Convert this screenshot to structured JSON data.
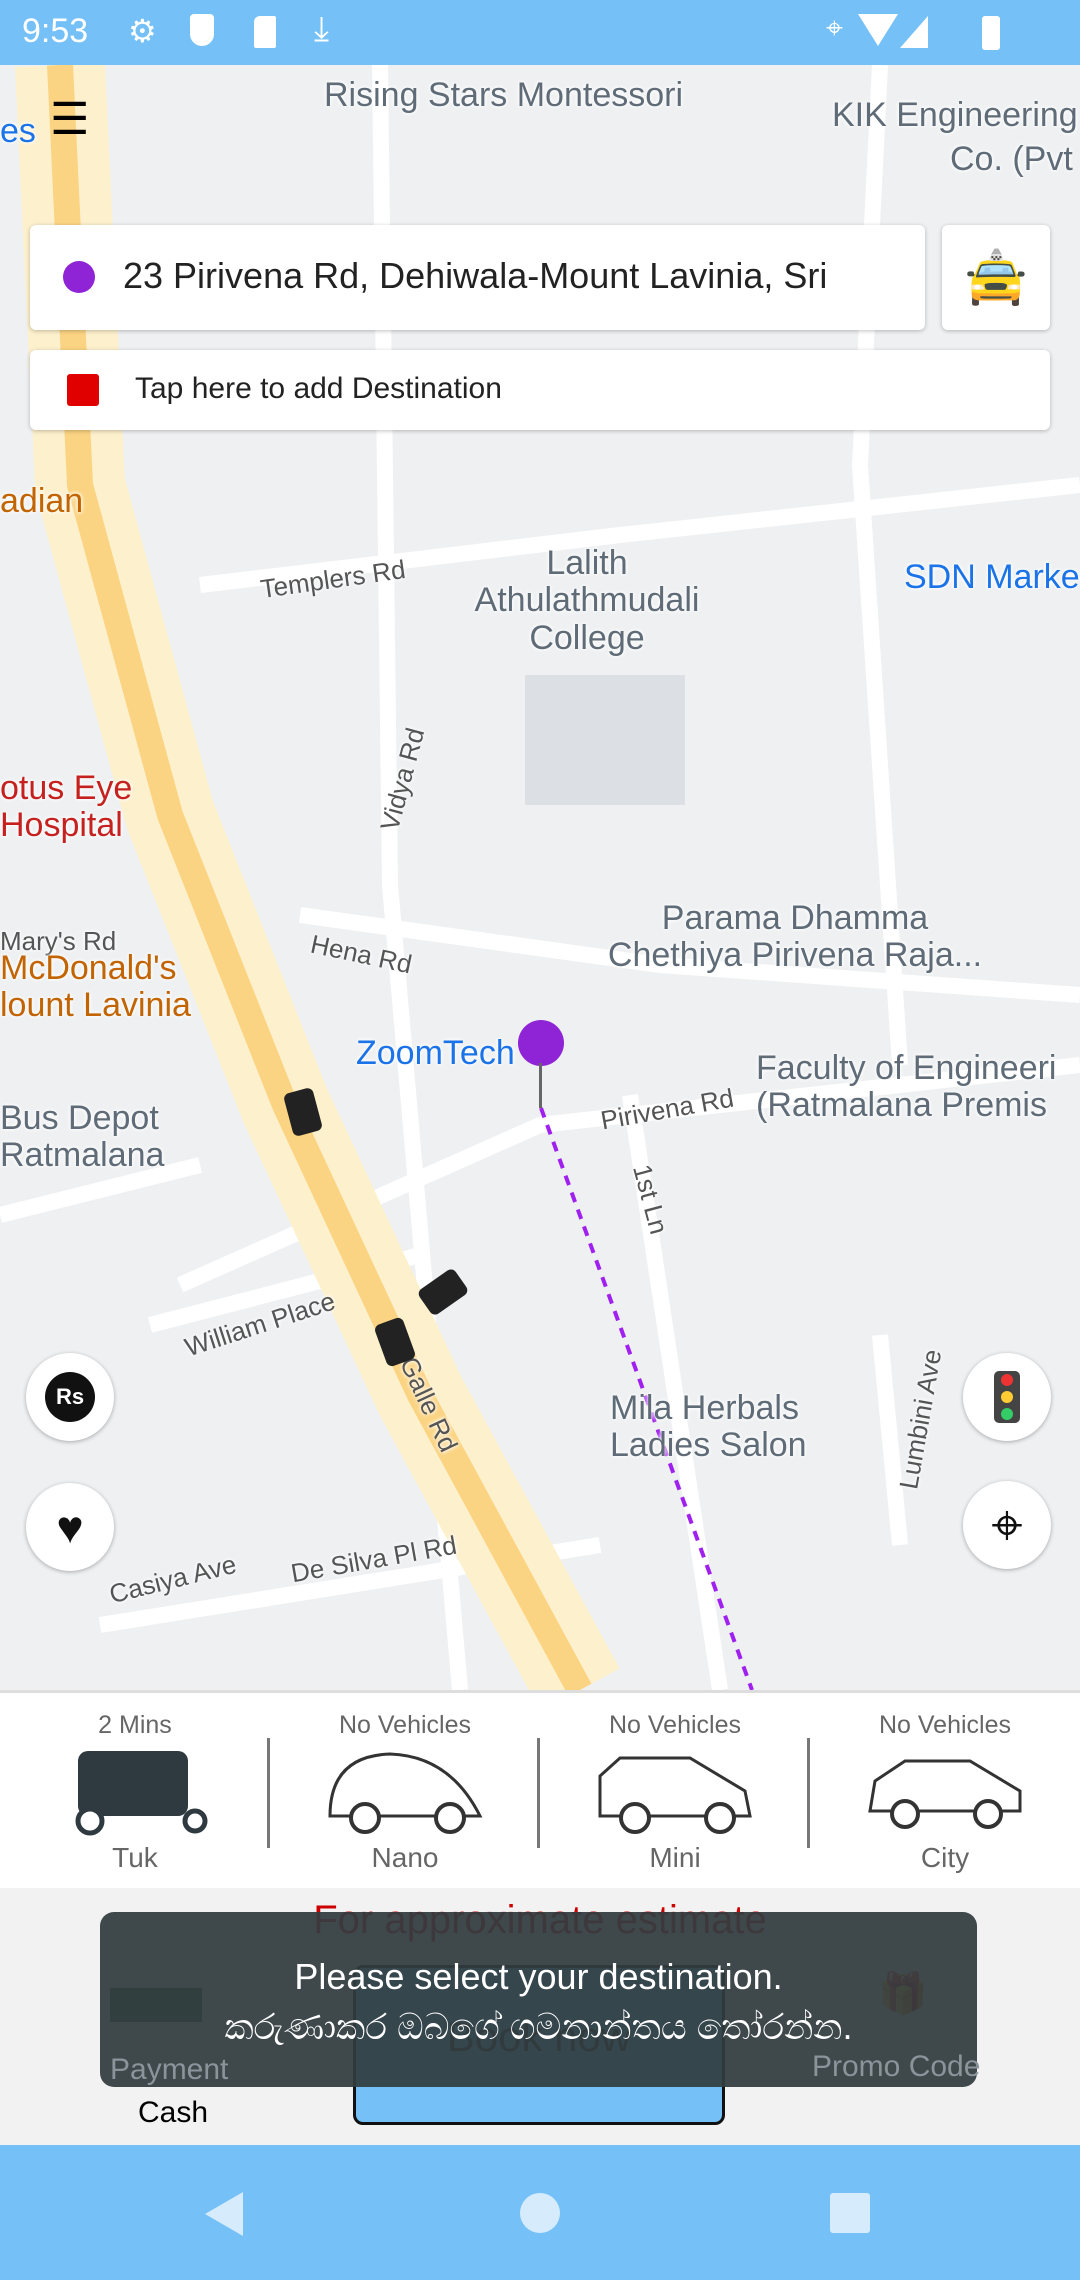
{
  "status_bar": {
    "time": "9:53",
    "icons": [
      "settings-icon",
      "shield-play-icon",
      "sd-card-icon",
      "download-icon",
      "location-icon",
      "wifi-icon",
      "signal-icon",
      "battery-icon"
    ]
  },
  "map": {
    "labels": [
      "Rising Stars Montessori",
      "KIK Engineering",
      "Co. (Pvt",
      "es",
      "adian",
      "Templers Rd",
      "Lalith",
      "Athulathmudali",
      "College",
      "SDN Marke",
      "Vidya Rd",
      "otus Eye",
      "Hospital",
      "Mary's Rd",
      "Hena Rd",
      "Parama Dhamma",
      "Chethiya Pirivena Raja...",
      "McDonald's",
      "lount Lavinia",
      "ZoomTech",
      "Faculty of Engineeri",
      "(Ratmalana Premis",
      "Bus Depot",
      "Ratmalana",
      "Pirivena Rd",
      "1st Ln",
      "William Place",
      "Galle Rd",
      "Mila Herbals",
      "Ladies Salon",
      "Lumbini Ave",
      "Casiya Ave",
      "De Silva Pl Rd"
    ],
    "pickup_color": "#8e24d6",
    "route_color": "#a020f0"
  },
  "search": {
    "pickup": "23 Pirivena Rd, Dehiwala-Mount Lavinia, Sri",
    "destination_placeholder": "Tap here to add Destination",
    "destination_color": "#e00000"
  },
  "fabs": {
    "rate": "Rs"
  },
  "vehicles": [
    {
      "status": "2 Mins",
      "name": "Tuk"
    },
    {
      "status": "No Vehicles",
      "name": "Nano"
    },
    {
      "status": "No Vehicles",
      "name": "Mini"
    },
    {
      "status": "No Vehicles",
      "name": "City"
    }
  ],
  "booking": {
    "estimate": "For approximate estimate",
    "payment_label": "Payment",
    "payment_value": "Cash",
    "book_label": "Book now",
    "promo_label": "Promo Code"
  },
  "toast": {
    "line1": "Please select your destination.",
    "line2": "කරුණාකර ඔබගේ ගමනාන්තය තෝරන්න."
  }
}
